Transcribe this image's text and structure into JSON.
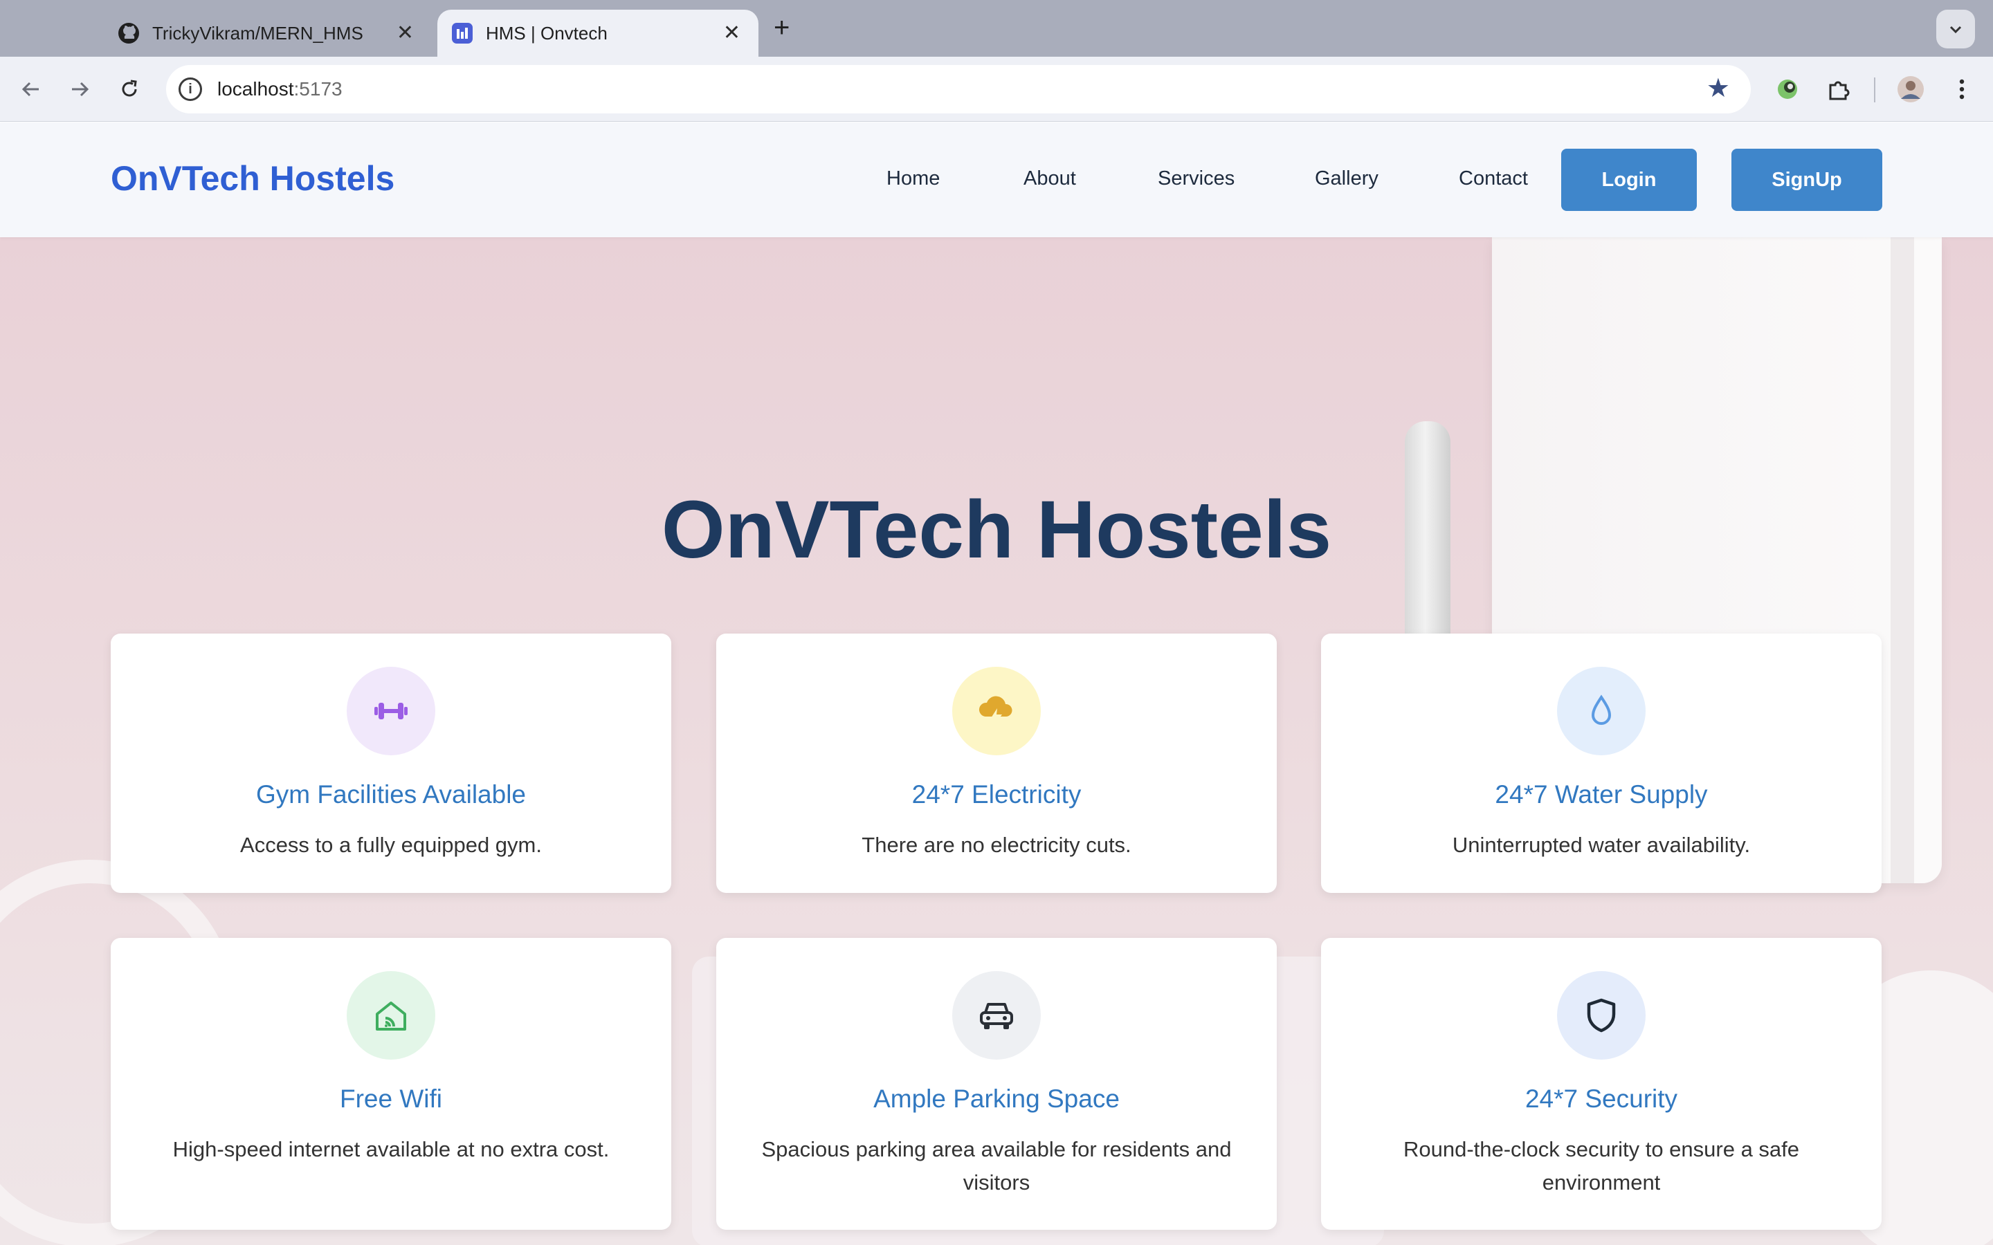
{
  "browser": {
    "tabs": [
      {
        "title": "TrickyVikram/MERN_HMS",
        "icon": "github-icon",
        "active": false
      },
      {
        "title": "HMS | Onvtech",
        "icon": "app-favicon",
        "active": true
      }
    ],
    "new_tab": "+",
    "url_host": "localhost",
    "url_port": ":5173"
  },
  "site": {
    "brand": "OnVTech Hostels",
    "nav": [
      "Home",
      "About",
      "Services",
      "Gallery",
      "Contact"
    ],
    "login": "Login",
    "signup": "SignUp"
  },
  "hero": {
    "title": "OnVTech Hostels"
  },
  "features": [
    {
      "title": "Gym Facilities Available",
      "desc": "Access to a fully equipped gym.",
      "icon": "dumbbell-icon",
      "icon_color": "#9b5de5",
      "bg_color": "#f1e8fb"
    },
    {
      "title": "24*7 Electricity",
      "desc": "There are no electricity cuts.",
      "icon": "lightning-cloud-icon",
      "icon_color": "#e0a82e",
      "bg_color": "#fdf6c6"
    },
    {
      "title": "24*7 Water Supply",
      "desc": "Uninterrupted water availability.",
      "icon": "water-drop-icon",
      "icon_color": "#5b9be3",
      "bg_color": "#e3eefc"
    },
    {
      "title": "Free Wifi",
      "desc": "High-speed internet available at no extra cost.",
      "icon": "home-wifi-icon",
      "icon_color": "#3fae5f",
      "bg_color": "#e3f6e8"
    },
    {
      "title": "Ample Parking Space",
      "desc": "Spacious parking area available for residents and visitors",
      "icon": "car-icon",
      "icon_color": "#2a2f36",
      "bg_color": "#eef0f3"
    },
    {
      "title": "24*7 Security",
      "desc": "Round-the-clock security to ensure a safe environment",
      "icon": "shield-icon",
      "icon_color": "#1f2a36",
      "bg_color": "#e4ecfb"
    }
  ]
}
